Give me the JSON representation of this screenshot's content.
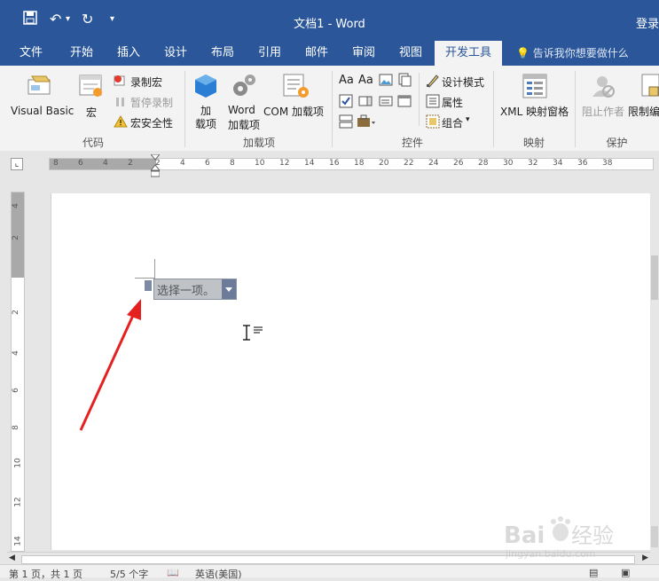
{
  "title_bar": {
    "document_title": "文档1 - Word",
    "login_label": "登录",
    "quick_access": [
      "save-icon",
      "undo-icon",
      "redo-icon",
      "customize-icon"
    ]
  },
  "tabs": [
    {
      "label": "文件"
    },
    {
      "label": "开始"
    },
    {
      "label": "插入"
    },
    {
      "label": "设计"
    },
    {
      "label": "布局"
    },
    {
      "label": "引用"
    },
    {
      "label": "邮件"
    },
    {
      "label": "审阅"
    },
    {
      "label": "视图"
    },
    {
      "label": "开发工具",
      "active": true
    }
  ],
  "tell_me": "告诉我你想要做什么",
  "ribbon": {
    "code": {
      "group_label": "代码",
      "visual_basic": "Visual Basic",
      "macros": "宏",
      "record_macro": "录制宏",
      "pause_recording": "暂停录制",
      "macro_security": "宏安全性"
    },
    "addins": {
      "group_label": "加载项",
      "addins_line1": "加",
      "addins_line2": "载项",
      "word_addins_line1": "Word",
      "word_addins_line2": "加载项",
      "com_addins": "COM 加载项"
    },
    "controls": {
      "group_label": "控件",
      "design_mode": "设计模式",
      "properties": "属性",
      "group": "组合"
    },
    "mapping": {
      "group_label": "映射",
      "xml_mapping": "XML 映射窗格"
    },
    "protect": {
      "group_label": "保护",
      "block_authors": "阻止作者",
      "restrict_editing": "限制编"
    }
  },
  "ruler": {
    "h_numbers": [
      "8",
      "6",
      "4",
      "2",
      "2",
      "4",
      "6",
      "8",
      "10",
      "12",
      "14",
      "16",
      "18",
      "20",
      "22",
      "24",
      "26",
      "28",
      "30",
      "32",
      "34",
      "36",
      "38"
    ],
    "v_numbers": [
      "4",
      "2",
      "2",
      "4",
      "6",
      "8",
      "10",
      "12",
      "14"
    ]
  },
  "document": {
    "content_control_placeholder": "选择一项。"
  },
  "status_bar": {
    "page": "第 1 页，共 1 页",
    "words": "5/5 个字",
    "language": "英语(美国)"
  },
  "watermark": {
    "brand": "Baidu经验",
    "url": "jingyan.baidu.com"
  },
  "colors": {
    "word_blue": "#2b579a",
    "ribbon_bg": "#f3f3f3",
    "arrow_red": "#e52020"
  }
}
